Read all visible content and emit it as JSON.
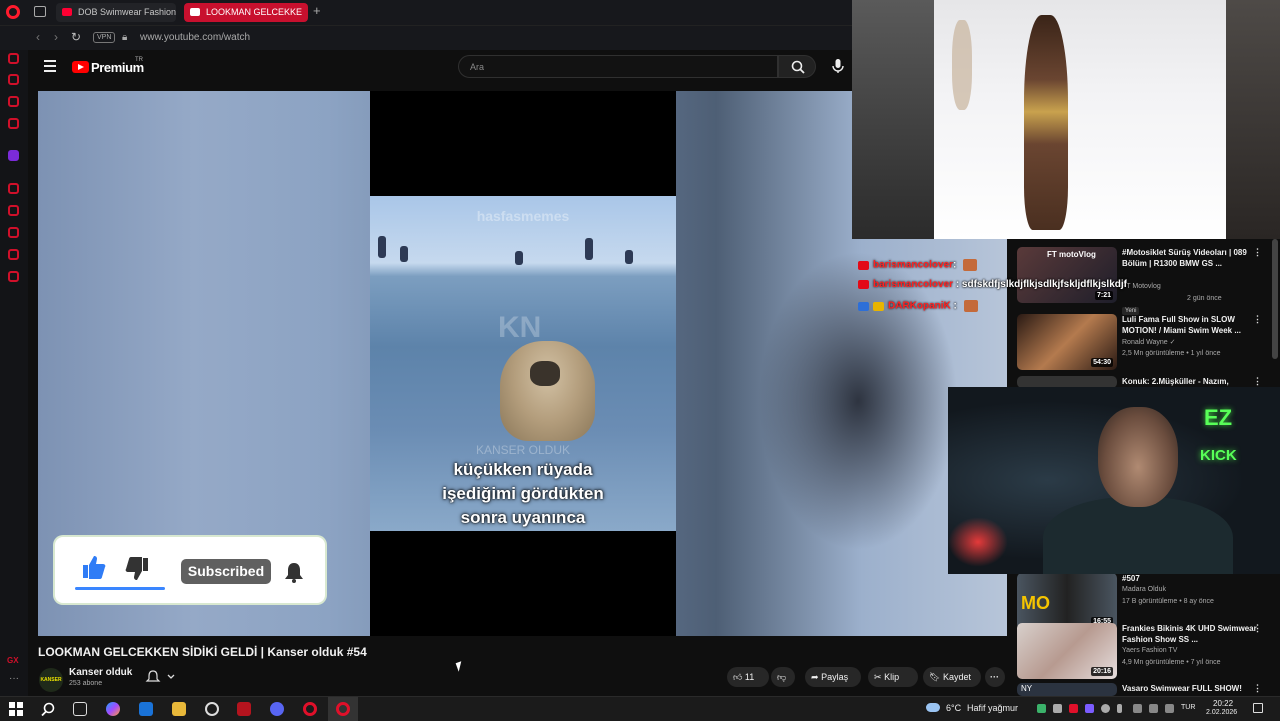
{
  "browser": {
    "tabs": [
      {
        "label": "DOB Swimwear Fashion S"
      },
      {
        "label": "LOOKMAN GELCEKKE"
      }
    ],
    "new_tab": "+",
    "vpn": "VPN",
    "url": "www.youtube.com/watch"
  },
  "youtube": {
    "logo": "Premium",
    "region": "TR",
    "search_placeholder": "Ara"
  },
  "player": {
    "watermark_top": "hasfasmemes",
    "watermark_logo": "KN",
    "watermark_mid": "KANSER OLDUK",
    "caption": "küçükken rüyada\nişediğimi gördükten\nsonra uyanınca",
    "subscribe_overlay": {
      "button": "Subscribed"
    }
  },
  "video": {
    "title": "LOOKMAN GELCEKKEN SİDİKİ GELDİ | Kanser olduk #54",
    "channel": "Kanser olduk",
    "channel_avatar": "KANSER OLDUK",
    "subscribers": "253 abone",
    "likes": "11",
    "share": "Paylaş",
    "clip": "Klip",
    "save": "Kaydet"
  },
  "chat": [
    {
      "user": "barismancolover",
      "sep": ":",
      "message": ""
    },
    {
      "user": "barismancolover",
      "sep": " :",
      "message": " sdfskdfjslkdjflkjsdlkjfskljdflkjslkdjf"
    },
    {
      "user": "DARKopaniK",
      "sep": " :",
      "message": ""
    }
  ],
  "recommendations": [
    {
      "title": "#Motosiklet Sürüş Videoları | 089 Bölüm | R1300 BMW GS ...",
      "channel": "FT Motovlog",
      "meta": "2 gün önce",
      "badge": "Yeni",
      "duration": "7:21",
      "thumb_label": "FT motoVlog"
    },
    {
      "title": "Luli Fama Full Show in SLOW MOTION! / Miami Swim Week ...",
      "channel": "Ronald Wayne ✓",
      "meta": "2,5 Mn görüntüleme • 1 yıl önce",
      "duration": "54:30"
    },
    {
      "title": "Konuk: 2.Müşküller - Nazım,",
      "channel": "",
      "meta": ""
    },
    {
      "title": "#507",
      "channel": "Madara Olduk",
      "meta": "17 B görüntüleme • 8 ay önce",
      "duration": "16:55",
      "thumb_label": "MO"
    },
    {
      "title": "Frankies Bikinis 4K UHD Swimwear Fashion Show SS ...",
      "channel": "Yaers Fashion TV",
      "meta": "4,9 Mn görüntüleme • 7 yıl önce",
      "duration": "20:16"
    },
    {
      "title": "Vasaro Swimwear FULL SHOW!",
      "channel": "",
      "meta": "",
      "thumb_label": "NY"
    }
  ],
  "stream_overlay": {
    "logo_top": "EZ",
    "logo_bottom": "KICK"
  },
  "taskbar": {
    "weather_temp": "6°C",
    "weather_desc": "Hafif yağmur",
    "language": "TUR",
    "time": "20:22",
    "date": "2.02.2026"
  },
  "sidebar_gx": "GX",
  "colors": {
    "brand_red": "#ff0000",
    "opera_red": "#d0102a",
    "kick_green": "#58ff58",
    "chat_name": "#ff2020"
  }
}
